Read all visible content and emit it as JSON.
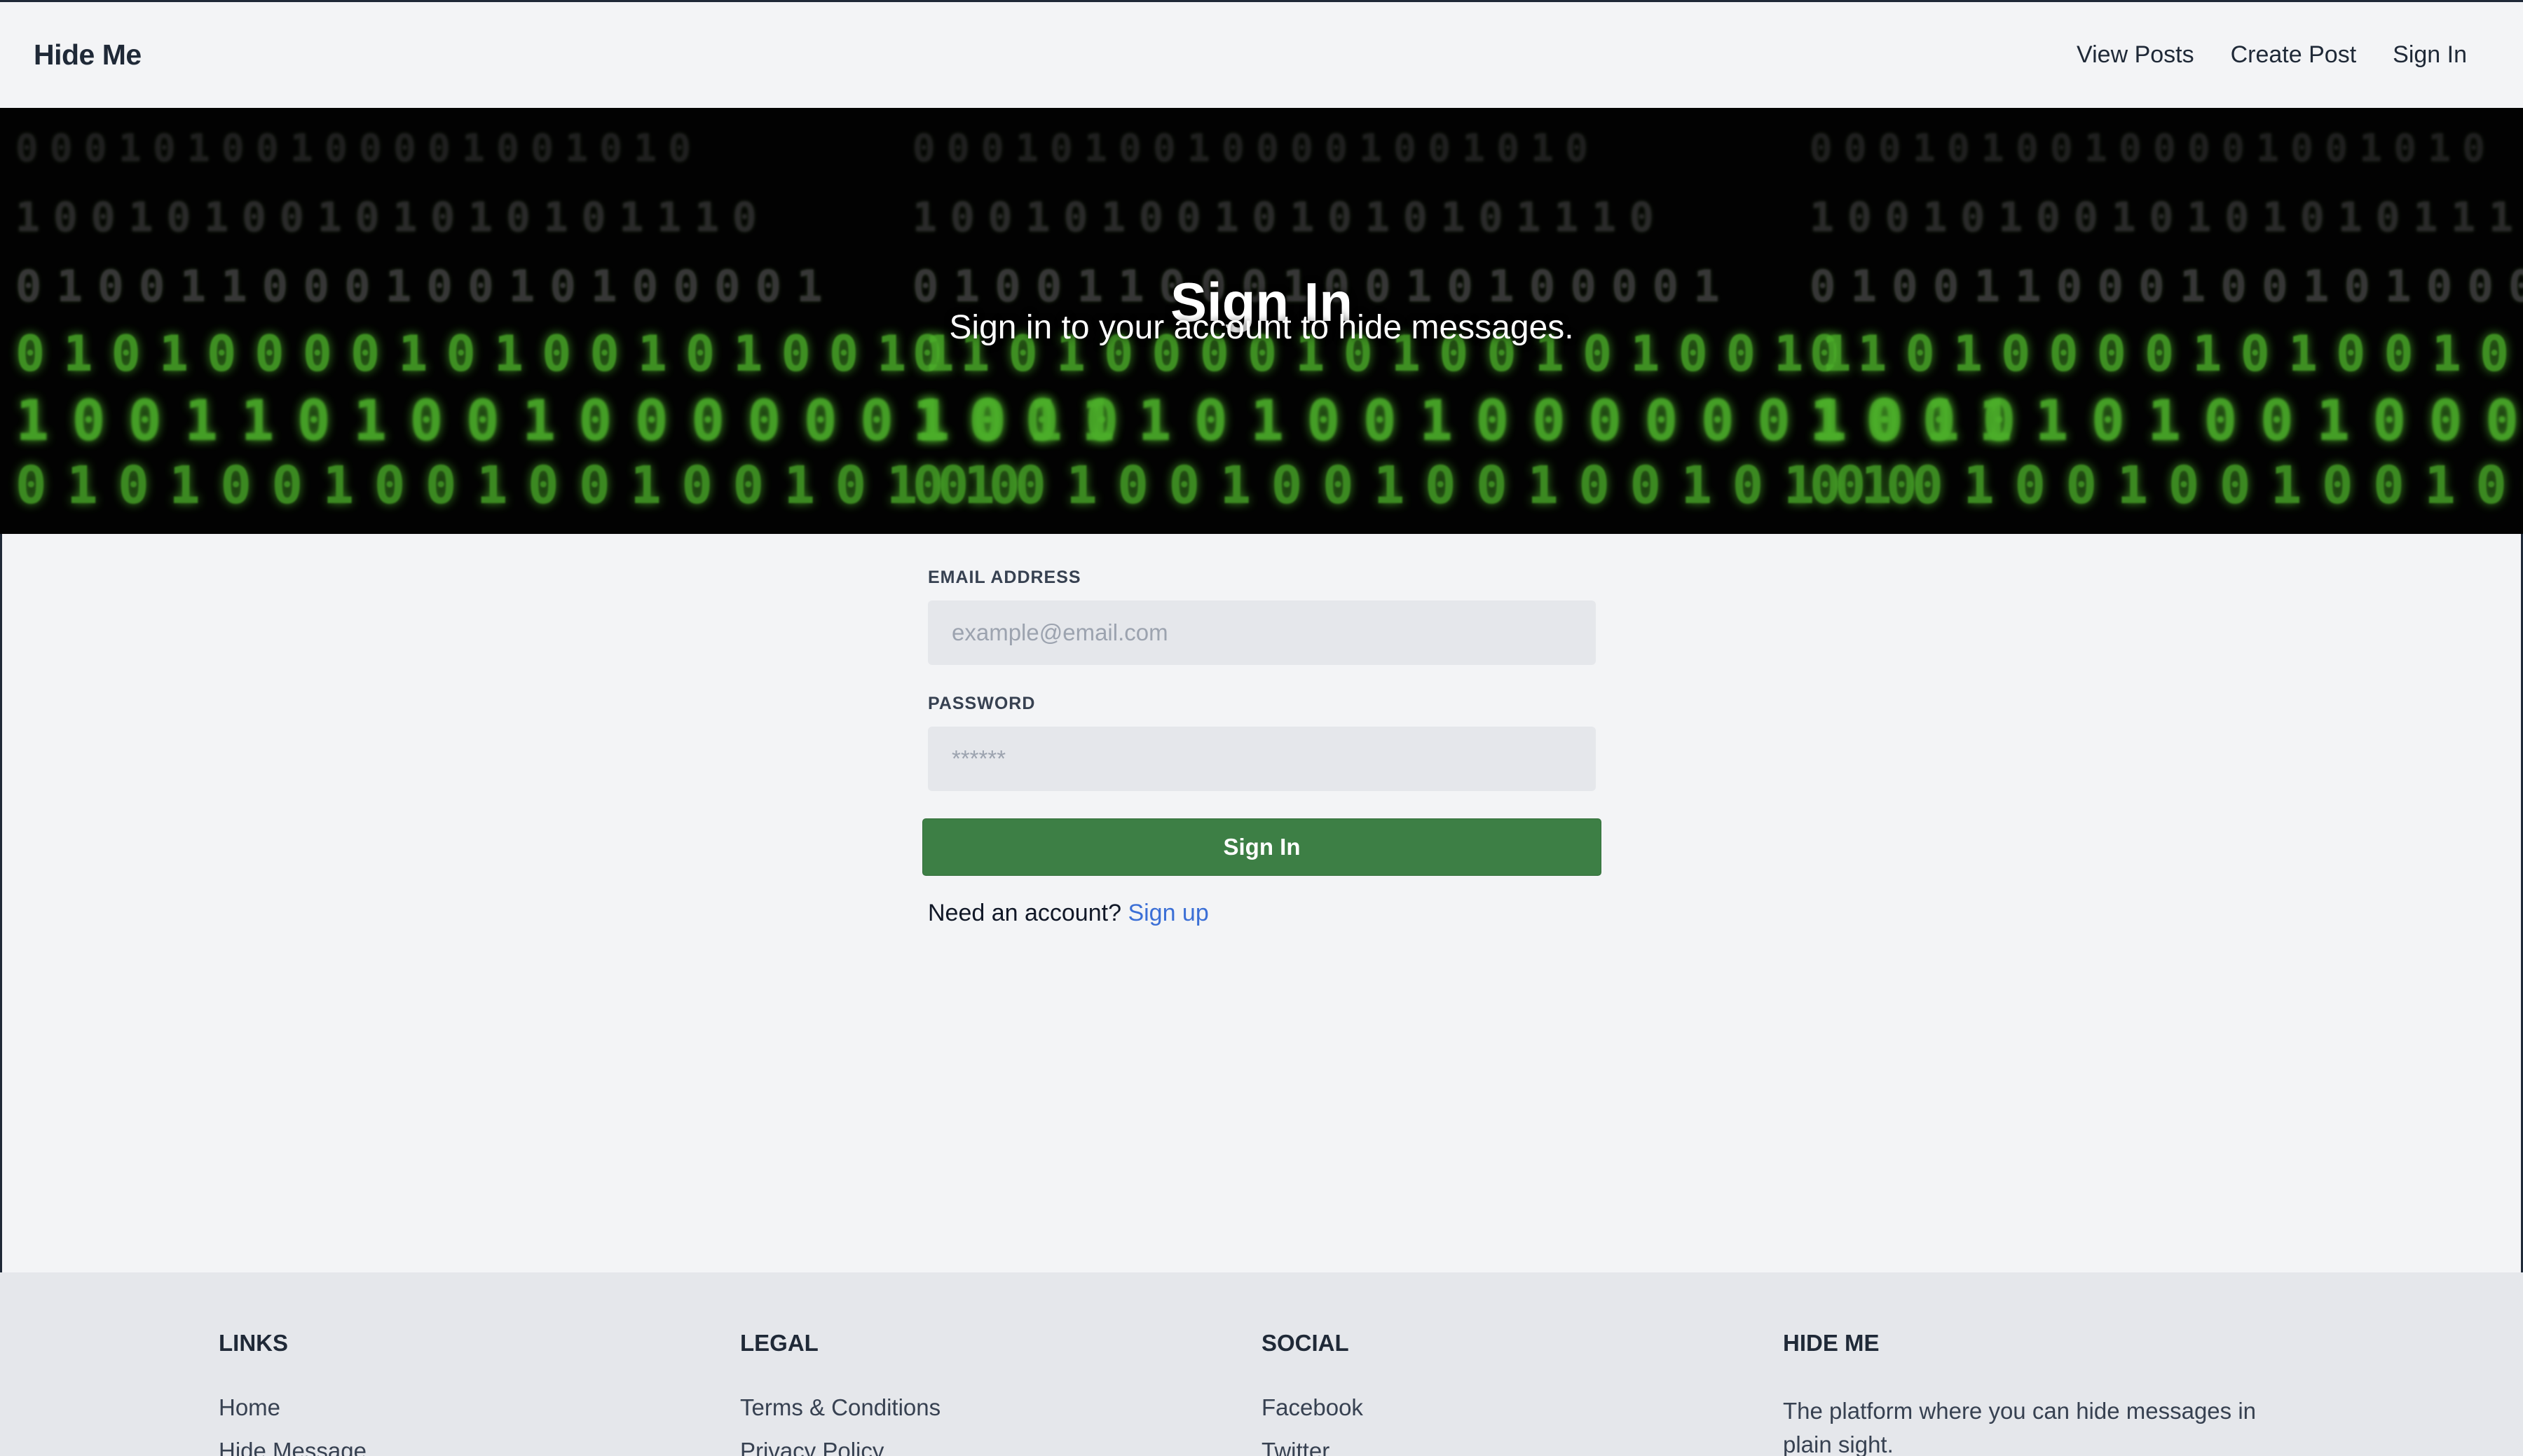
{
  "nav": {
    "brand": "Hide Me",
    "links": [
      "View Posts",
      "Create Post",
      "Sign In"
    ]
  },
  "hero": {
    "title": "Sign In",
    "subtitle": "Sign in to your account to hide messages.",
    "background_rows": [
      "00010100100001001010",
      "10010100101010101110",
      "01001100010010100001",
      "01010000101001010011",
      "10011010010000001010",
      "01010010010010010100"
    ]
  },
  "form": {
    "email_label": "EMAIL ADDRESS",
    "email_placeholder": "example@email.com",
    "password_label": "PASSWORD",
    "password_placeholder": "******",
    "submit_label": "Sign In",
    "signup_prompt": "Need an account?",
    "signup_link": "Sign up"
  },
  "footer": {
    "links": {
      "heading": "LINKS",
      "items": [
        "Home",
        "Hide Message"
      ]
    },
    "legal": {
      "heading": "LEGAL",
      "items": [
        "Terms & Conditions",
        "Privacy Policy"
      ]
    },
    "social": {
      "heading": "SOCIAL",
      "items": [
        "Facebook",
        "Twitter"
      ]
    },
    "about": {
      "heading": "HIDE ME",
      "text": "The platform where you can hide messages in plain sight."
    }
  },
  "colors": {
    "page_bg": "#f3f4f6",
    "hero_bg": "#020202",
    "binary_green": "#4caf2a",
    "primary_button": "#3d7f45",
    "link": "#3b6fd6",
    "footer_bg": "#e5e7eb"
  }
}
